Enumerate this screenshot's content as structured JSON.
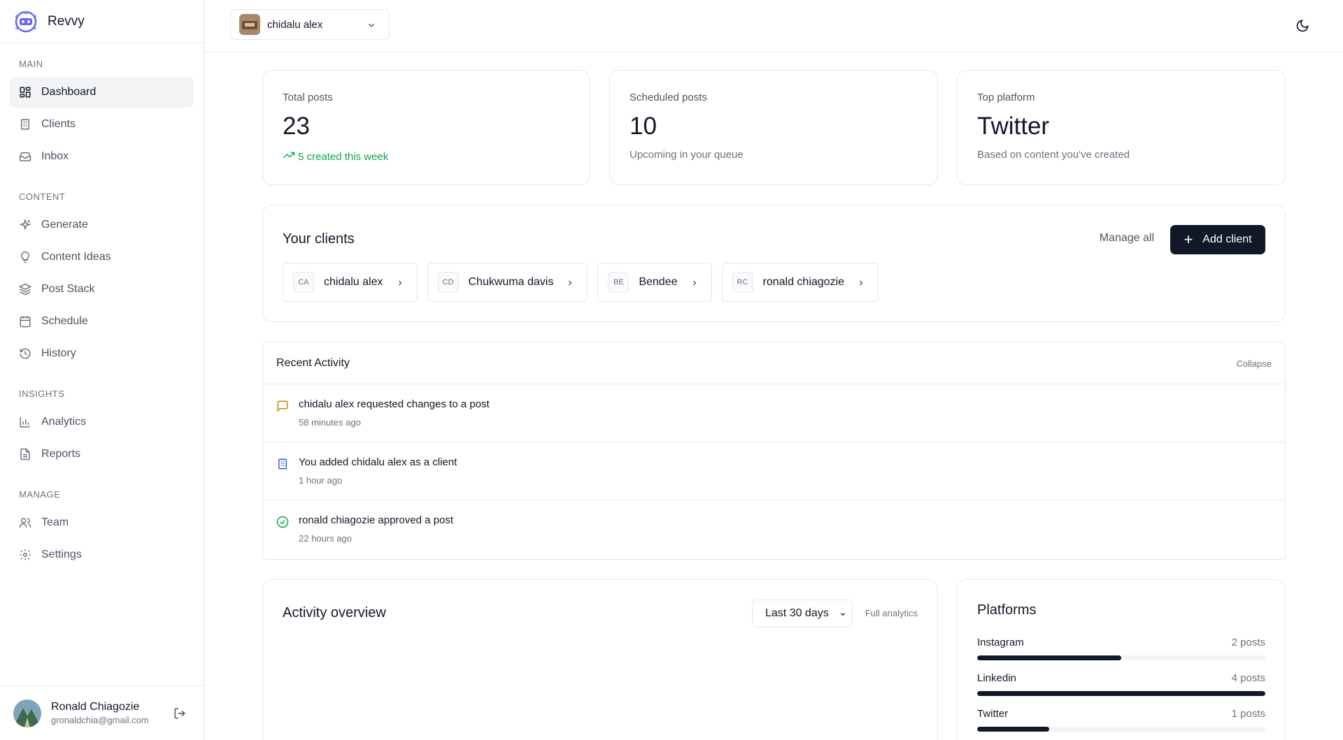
{
  "brand": {
    "name": "Revvy"
  },
  "sidebar": {
    "sections": [
      {
        "label": "MAIN",
        "items": [
          {
            "label": "Dashboard",
            "icon": "dashboard-icon",
            "active": true
          },
          {
            "label": "Clients",
            "icon": "building-icon"
          },
          {
            "label": "Inbox",
            "icon": "inbox-icon"
          }
        ]
      },
      {
        "label": "CONTENT",
        "items": [
          {
            "label": "Generate",
            "icon": "sparkles-icon"
          },
          {
            "label": "Content Ideas",
            "icon": "lightbulb-icon"
          },
          {
            "label": "Post Stack",
            "icon": "layers-icon"
          },
          {
            "label": "Schedule",
            "icon": "calendar-icon"
          },
          {
            "label": "History",
            "icon": "history-icon"
          }
        ]
      },
      {
        "label": "INSIGHTS",
        "items": [
          {
            "label": "Analytics",
            "icon": "bar-chart-icon"
          },
          {
            "label": "Reports",
            "icon": "file-text-icon"
          }
        ]
      },
      {
        "label": "MANAGE",
        "items": [
          {
            "label": "Team",
            "icon": "users-icon"
          },
          {
            "label": "Settings",
            "icon": "gear-icon"
          }
        ]
      }
    ],
    "user": {
      "name": "Ronald Chiagozie",
      "email": "gronaldchia@gmail.com"
    }
  },
  "topbar": {
    "selected_client": "chidalu alex"
  },
  "stats": [
    {
      "label": "Total posts",
      "value": "23",
      "note": "5 created this week",
      "trend": "up"
    },
    {
      "label": "Scheduled posts",
      "value": "10",
      "note": "Upcoming in your queue"
    },
    {
      "label": "Top platform",
      "value": "Twitter",
      "note": "Based on content you've created"
    }
  ],
  "clients": {
    "title": "Your clients",
    "manage_label": "Manage all",
    "add_label": "Add client",
    "items": [
      {
        "initials": "CA",
        "name": "chidalu alex"
      },
      {
        "initials": "CD",
        "name": "Chukwuma davis"
      },
      {
        "initials": "BE",
        "name": "Bendee"
      },
      {
        "initials": "RC",
        "name": "ronald chiagozie"
      }
    ]
  },
  "recent": {
    "title": "Recent Activity",
    "collapse_label": "Collapse",
    "items": [
      {
        "text": "chidalu alex requested changes to a post",
        "time": "58 minutes ago",
        "icon": "message-icon",
        "color": "#ca8a04"
      },
      {
        "text": "You added chidalu alex as a client",
        "time": "1 hour ago",
        "icon": "building-icon",
        "color": "#2563eb"
      },
      {
        "text": "ronald chiagozie approved a post",
        "time": "22 hours ago",
        "icon": "check-circle-icon",
        "color": "#16a34a"
      }
    ]
  },
  "activity_overview": {
    "title": "Activity overview",
    "range": "Last 30 days",
    "full_label": "Full analytics"
  },
  "platforms": {
    "title": "Platforms",
    "items": [
      {
        "name": "Instagram",
        "count": "2 posts",
        "fraction": 0.5
      },
      {
        "name": "Linkedin",
        "count": "4 posts",
        "fraction": 1.0
      },
      {
        "name": "Twitter",
        "count": "1 posts",
        "fraction": 0.25
      }
    ]
  },
  "colors": {
    "primary": "#111827",
    "success": "#16a34a",
    "warning": "#ca8a04",
    "info": "#2563eb",
    "border": "#e5e7eb"
  }
}
